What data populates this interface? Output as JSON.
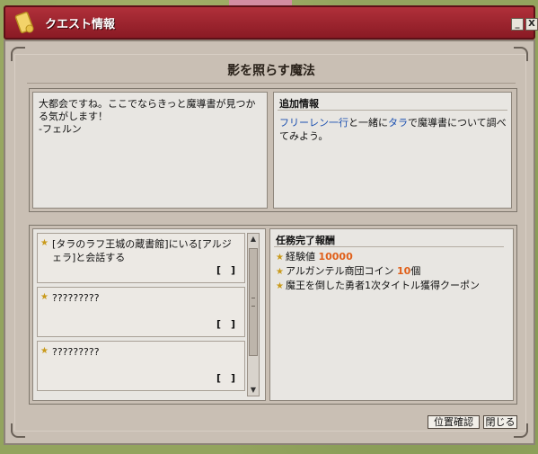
{
  "window": {
    "title": "クエスト情報",
    "minimize_glyph": "_",
    "close_glyph": "X"
  },
  "quest": {
    "title": "影を照らす魔法",
    "dialog": "大都会ですね。ここでならきっと魔導書が見つかる気がします！\n-フェルン"
  },
  "additional_info": {
    "label": "追加情報",
    "name1": "フリーレン一行",
    "text1": "と一緒に",
    "name2": "タラ",
    "text2": "で魔導書について調べてみよう。"
  },
  "objectives": [
    {
      "text": "[タラのラフ王城の蔵書館]にいる[アルジェラ]と会話する",
      "status": "[　]"
    },
    {
      "text": "?????????",
      "status": "[　]"
    },
    {
      "text": "?????????",
      "status": "[　]"
    }
  ],
  "rewards": {
    "label": "任務完了報酬",
    "items": [
      {
        "name": "経験値",
        "amount": "10000",
        "unit": ""
      },
      {
        "name": "アルガンテル商団コイン",
        "amount": "10",
        "unit": "個"
      },
      {
        "name": "魔王を倒した勇者1次タイトル獲得クーポン",
        "amount": "",
        "unit": ""
      }
    ]
  },
  "buttons": {
    "location": "位置確認",
    "close": "閉じる"
  },
  "icons": {
    "window": "scroll-icon",
    "star": "star-icon"
  }
}
